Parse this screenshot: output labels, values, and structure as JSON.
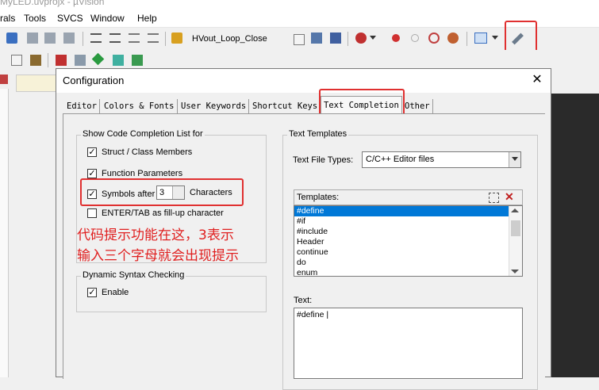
{
  "window": {
    "title": "MyLED.uvprojx - µVision"
  },
  "menu": {
    "items": [
      "rals",
      "Tools",
      "SVCS",
      "Window",
      "Help"
    ]
  },
  "toolbar": {
    "target_combo": "HVout_Loop_Close"
  },
  "dialog": {
    "title": "Configuration",
    "close_glyph": "✕",
    "tabs": [
      "Editor",
      "Colors & Fonts",
      "User Keywords",
      "Shortcut Keys",
      "Text Completion",
      "Other"
    ],
    "active_tab": "Text Completion",
    "code_completion": {
      "group_label": "Show Code Completion List for",
      "struct_members": {
        "label": "Struct / Class Members",
        "checked": true
      },
      "function_params": {
        "label": "Function Parameters",
        "checked": true
      },
      "symbols_after": {
        "label": "Symbols after",
        "value": "3",
        "suffix": "Characters",
        "checked": true
      },
      "enter_tab": {
        "label": "ENTER/TAB as fill-up character",
        "checked": false
      }
    },
    "annotation": {
      "line1": "代码提示功能在这，3表示",
      "line2": "输入三个字母就会出现提示"
    },
    "syntax_checking": {
      "group_label": "Dynamic Syntax Checking",
      "enable": {
        "label": "Enable",
        "checked": true
      }
    },
    "text_templates": {
      "group_label": "Text Templates",
      "file_types_label": "Text File Types:",
      "file_types_value": "C/C++ Editor files",
      "templates_label": "Templates:",
      "templates": [
        "#define",
        "#if",
        "#include",
        "Header",
        "continue",
        "do",
        "enum"
      ],
      "selected_template": "#define",
      "text_label": "Text:",
      "text_value": "#define |"
    }
  },
  "colors": {
    "annotation": "#e02020",
    "highlight_box": "#e03030",
    "selection": "#0078d7"
  }
}
